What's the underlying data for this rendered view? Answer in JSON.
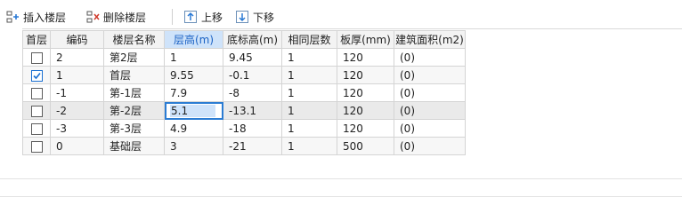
{
  "toolbar": {
    "insert_label": "插入楼层",
    "delete_label": "删除楼层",
    "up_label": "上移",
    "down_label": "下移"
  },
  "columns": [
    "首层",
    "编码",
    "楼层名称",
    "层高(m)",
    "底标高(m)",
    "相同层数",
    "板厚(mm)",
    "建筑面积(m2)"
  ],
  "rows": [
    {
      "first": false,
      "code": "2",
      "name": "第2层",
      "height": "1",
      "bottom": "9.45",
      "same": "1",
      "slab": "120",
      "area": "(0)"
    },
    {
      "first": true,
      "code": "1",
      "name": "首层",
      "height": "9.55",
      "bottom": "-0.1",
      "same": "1",
      "slab": "120",
      "area": "(0)"
    },
    {
      "first": false,
      "code": "-1",
      "name": "第-1层",
      "height": "7.9",
      "bottom": "-8",
      "same": "1",
      "slab": "120",
      "area": "(0)"
    },
    {
      "first": false,
      "code": "-2",
      "name": "第-2层",
      "height": "5.1",
      "bottom": "-13.1",
      "same": "1",
      "slab": "120",
      "area": "(0)"
    },
    {
      "first": false,
      "code": "-3",
      "name": "第-3层",
      "height": "4.9",
      "bottom": "-18",
      "same": "1",
      "slab": "120",
      "area": "(0)"
    },
    {
      "first": false,
      "code": "0",
      "name": "基础层",
      "height": "3",
      "bottom": "-21",
      "same": "1",
      "slab": "500",
      "area": "(0)"
    }
  ],
  "colors": {
    "accent": "#1a6fd1",
    "header_active_bg": "#cfe3fa",
    "header_bg": "#f3f3f3",
    "grid_line": "#d4d4d4"
  },
  "icons": [
    "insert-floor-icon",
    "delete-floor-icon",
    "move-up-icon",
    "move-down-icon",
    "checkmark-icon"
  ]
}
